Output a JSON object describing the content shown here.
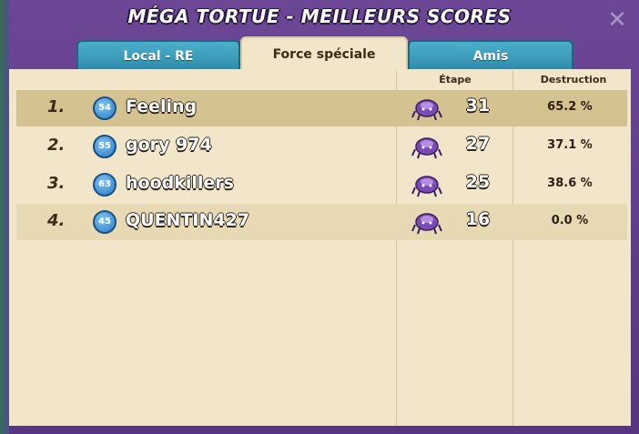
{
  "window": {
    "title": "MÉGA TORTUE - MEILLEURS SCORES",
    "close_icon": "close-icon"
  },
  "tabs": [
    {
      "label": "Local - RE",
      "active": false
    },
    {
      "label": "Force spéciale",
      "active": true
    },
    {
      "label": "Amis",
      "active": false
    }
  ],
  "columns": {
    "stage": "Étape",
    "destruction": "Destruction"
  },
  "rows": [
    {
      "rank": "1.",
      "level": "54",
      "name": "Feeling",
      "stage": "31",
      "destruction": "65.2 %"
    },
    {
      "rank": "2.",
      "level": "55",
      "name": "gory 974",
      "stage": "27",
      "destruction": "37.1 %"
    },
    {
      "rank": "3.",
      "level": "63",
      "name": "hoodkillers",
      "stage": "25",
      "destruction": "38.6 %"
    },
    {
      "rank": "4.",
      "level": "45",
      "name": "QUENTIN427",
      "stage": "16",
      "destruction": "0.0 %"
    }
  ],
  "colors": {
    "frame": "#5b3a86",
    "panel": "#f1e6c9",
    "tab_blue": "#2d8aa8",
    "level_badge": "#2a7cc6"
  }
}
